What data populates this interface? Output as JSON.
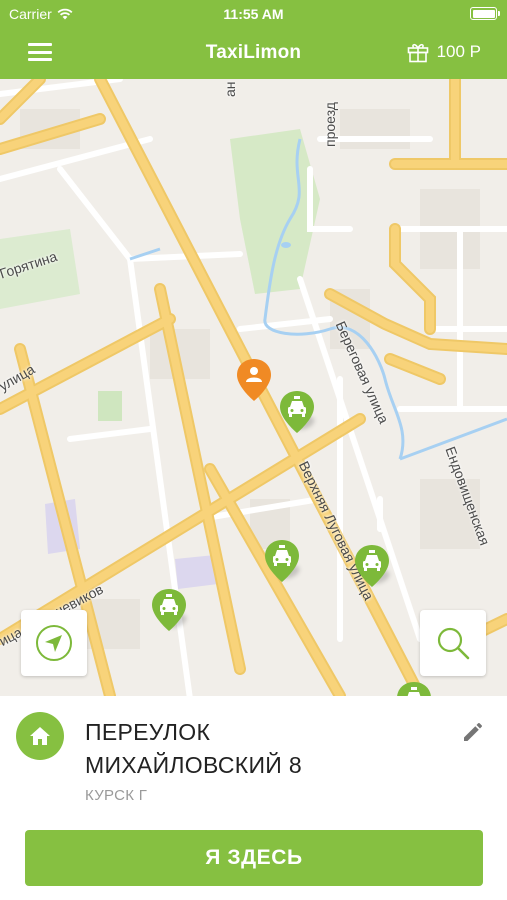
{
  "status_bar": {
    "carrier": "Carrier",
    "time": "11:55 AM"
  },
  "nav": {
    "title": "TaxiLimon",
    "bonus_amount": "100 Р"
  },
  "map": {
    "streets": {
      "s1": "Горятина",
      "s2": "улица",
      "s3": "проезд",
      "s4": "ан",
      "s5": "Береговая улица",
      "s6": "Верхняя Луговая улица",
      "s7": "Ендовищенская",
      "s8": "ица Большевиков"
    },
    "icons": {
      "user_pin": "person-icon",
      "taxi": "taxi-icon",
      "locate": "locate-arrow-icon",
      "search": "search-icon"
    }
  },
  "address": {
    "line1": "ПЕРЕУЛОК",
    "line2": "МИХАЙЛОВСКИЙ 8",
    "city": "КУРСК Г"
  },
  "actions": {
    "confirm_label": "Я ЗДЕСЬ"
  },
  "colors": {
    "brand": "#86c041",
    "user_pin": "#f08a24",
    "road": "#f8d37a"
  }
}
